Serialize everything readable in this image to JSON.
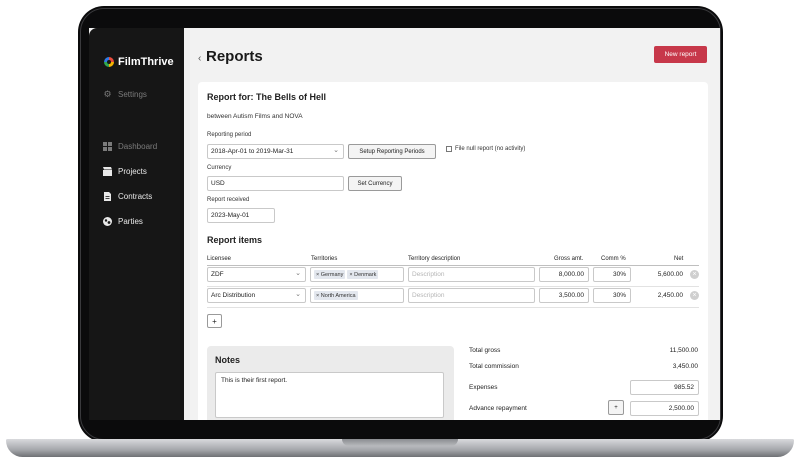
{
  "app": {
    "name": "FilmThrive"
  },
  "sidebar": {
    "settings": "Settings",
    "items": [
      {
        "label": "Dashboard",
        "icon": "dashboard-icon"
      },
      {
        "label": "Projects",
        "icon": "clapperboard-icon"
      },
      {
        "label": "Contracts",
        "icon": "document-icon"
      },
      {
        "label": "Parties",
        "icon": "globe-icon"
      }
    ]
  },
  "header": {
    "title": "Reports",
    "new_report_label": "New report"
  },
  "report": {
    "heading": "Report for: The Bells of Hell",
    "between": "between Autism Films and NOVA",
    "period_label": "Reporting period",
    "period_value": "2018-Apr-01 to 2019-Mar-31",
    "setup_periods_label": "Setup Reporting Periods",
    "file_null_label": "File null report (no activity)",
    "currency_label": "Currency",
    "currency_value": "USD",
    "set_currency_label": "Set Currency",
    "received_label": "Report received",
    "received_value": "2023-May-01"
  },
  "items": {
    "heading": "Report items",
    "columns": {
      "licensee": "Licensee",
      "territories": "Territories",
      "description": "Territory description",
      "gross": "Gross amt.",
      "comm": "Comm %",
      "net": "Net"
    },
    "description_placeholder": "Description",
    "rows": [
      {
        "licensee": "ZDF",
        "territories": [
          "× Germany",
          "× Denmark"
        ],
        "gross": "8,000.00",
        "comm": "30%",
        "net": "5,600.00"
      },
      {
        "licensee": "Arc Distribution",
        "territories": [
          "× North America"
        ],
        "gross": "3,500.00",
        "comm": "30%",
        "net": "2,450.00"
      }
    ],
    "add_label": "+",
    "remove_glyph": "×"
  },
  "notes": {
    "title": "Notes",
    "text": "This is their first report."
  },
  "summary": {
    "total_gross_label": "Total gross",
    "total_gross": "11,500.00",
    "total_commission_label": "Total commission",
    "total_commission": "3,450.00",
    "expenses_label": "Expenses",
    "expenses": "985.52",
    "advance_label": "Advance repayment",
    "advance_add": "+",
    "advance": "2,500.00"
  }
}
